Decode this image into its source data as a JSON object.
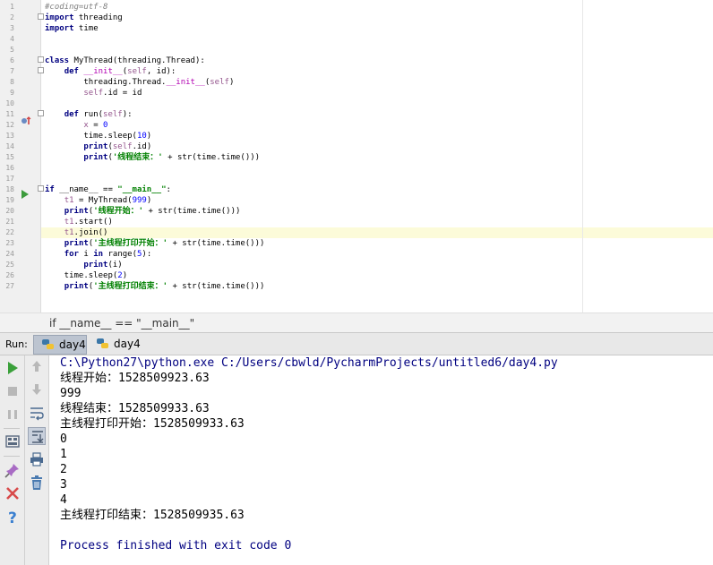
{
  "editor": {
    "current_line": 22,
    "lines": [
      {
        "n": 1,
        "parts": [
          {
            "t": "#coding=utf-8",
            "c": "cm"
          }
        ]
      },
      {
        "n": 2,
        "parts": [
          {
            "t": "import",
            "c": "kw"
          },
          {
            "t": " threading",
            "c": "plain"
          }
        ]
      },
      {
        "n": 3,
        "parts": [
          {
            "t": "import",
            "c": "kw"
          },
          {
            "t": " time",
            "c": "plain"
          }
        ]
      },
      {
        "n": 4,
        "parts": []
      },
      {
        "n": 5,
        "parts": []
      },
      {
        "n": 6,
        "parts": [
          {
            "t": "class",
            "c": "kw"
          },
          {
            "t": " MyThread(threading.Thread):",
            "c": "plain"
          }
        ]
      },
      {
        "n": 7,
        "parts": [
          {
            "t": "    ",
            "c": "plain"
          },
          {
            "t": "def",
            "c": "kw"
          },
          {
            "t": " ",
            "c": "plain"
          },
          {
            "t": "__init__",
            "c": "mag"
          },
          {
            "t": "(",
            "c": "plain"
          },
          {
            "t": "self",
            "c": "self"
          },
          {
            "t": ", id):",
            "c": "plain"
          }
        ]
      },
      {
        "n": 8,
        "parts": [
          {
            "t": "        threading.Thread.",
            "c": "plain"
          },
          {
            "t": "__init__",
            "c": "mag"
          },
          {
            "t": "(",
            "c": "plain"
          },
          {
            "t": "self",
            "c": "self"
          },
          {
            "t": ")",
            "c": "plain"
          }
        ]
      },
      {
        "n": 9,
        "parts": [
          {
            "t": "        ",
            "c": "plain"
          },
          {
            "t": "self",
            "c": "self"
          },
          {
            "t": ".id = id",
            "c": "plain"
          }
        ]
      },
      {
        "n": 10,
        "parts": []
      },
      {
        "n": 11,
        "parts": [
          {
            "t": "    ",
            "c": "plain"
          },
          {
            "t": "def",
            "c": "kw"
          },
          {
            "t": " run(",
            "c": "plain"
          },
          {
            "t": "self",
            "c": "self"
          },
          {
            "t": "):",
            "c": "plain"
          }
        ]
      },
      {
        "n": 12,
        "parts": [
          {
            "t": "        ",
            "c": "plain"
          },
          {
            "t": "x",
            "c": "self"
          },
          {
            "t": " = ",
            "c": "plain"
          },
          {
            "t": "0",
            "c": "num"
          }
        ]
      },
      {
        "n": 13,
        "parts": [
          {
            "t": "        time.sleep(",
            "c": "plain"
          },
          {
            "t": "10",
            "c": "num"
          },
          {
            "t": ")",
            "c": "plain"
          }
        ]
      },
      {
        "n": 14,
        "parts": [
          {
            "t": "        ",
            "c": "plain"
          },
          {
            "t": "print",
            "c": "kw"
          },
          {
            "t": "(",
            "c": "plain"
          },
          {
            "t": "self",
            "c": "self"
          },
          {
            "t": ".id)",
            "c": "plain"
          }
        ]
      },
      {
        "n": 15,
        "parts": [
          {
            "t": "        ",
            "c": "plain"
          },
          {
            "t": "print",
            "c": "kw"
          },
          {
            "t": "(",
            "c": "plain"
          },
          {
            "t": "'线程结束：'",
            "c": "str"
          },
          {
            "t": " + str(time.time()))",
            "c": "plain"
          }
        ]
      },
      {
        "n": 16,
        "parts": []
      },
      {
        "n": 17,
        "parts": []
      },
      {
        "n": 18,
        "parts": [
          {
            "t": "if",
            "c": "kw"
          },
          {
            "t": " __name__ == ",
            "c": "plain"
          },
          {
            "t": "\"__main__\"",
            "c": "str"
          },
          {
            "t": ":",
            "c": "plain"
          }
        ]
      },
      {
        "n": 19,
        "parts": [
          {
            "t": "    ",
            "c": "plain"
          },
          {
            "t": "t1",
            "c": "self"
          },
          {
            "t": " = MyThread(",
            "c": "plain"
          },
          {
            "t": "999",
            "c": "num"
          },
          {
            "t": ")",
            "c": "plain"
          }
        ]
      },
      {
        "n": 20,
        "parts": [
          {
            "t": "    ",
            "c": "plain"
          },
          {
            "t": "print",
            "c": "kw"
          },
          {
            "t": "(",
            "c": "plain"
          },
          {
            "t": "'线程开始：'",
            "c": "str"
          },
          {
            "t": " + str(time.time()))",
            "c": "plain"
          }
        ]
      },
      {
        "n": 21,
        "parts": [
          {
            "t": "    ",
            "c": "plain"
          },
          {
            "t": "t1",
            "c": "self"
          },
          {
            "t": ".start()",
            "c": "plain"
          }
        ]
      },
      {
        "n": 22,
        "parts": [
          {
            "t": "    ",
            "c": "plain"
          },
          {
            "t": "t1",
            "c": "self"
          },
          {
            "t": ".join()",
            "c": "plain"
          }
        ]
      },
      {
        "n": 23,
        "parts": [
          {
            "t": "    ",
            "c": "plain"
          },
          {
            "t": "print",
            "c": "kw"
          },
          {
            "t": "(",
            "c": "plain"
          },
          {
            "t": "'主线程打印开始：'",
            "c": "str"
          },
          {
            "t": " + str(time.time()))",
            "c": "plain"
          }
        ]
      },
      {
        "n": 24,
        "parts": [
          {
            "t": "    ",
            "c": "plain"
          },
          {
            "t": "for",
            "c": "kw"
          },
          {
            "t": " i ",
            "c": "plain"
          },
          {
            "t": "in",
            "c": "kw"
          },
          {
            "t": " range(",
            "c": "plain"
          },
          {
            "t": "5",
            "c": "num"
          },
          {
            "t": "):",
            "c": "plain"
          }
        ]
      },
      {
        "n": 25,
        "parts": [
          {
            "t": "        ",
            "c": "plain"
          },
          {
            "t": "print",
            "c": "kw"
          },
          {
            "t": "(i)",
            "c": "plain"
          }
        ]
      },
      {
        "n": 26,
        "parts": [
          {
            "t": "    time.sleep(",
            "c": "plain"
          },
          {
            "t": "2",
            "c": "num"
          },
          {
            "t": ")",
            "c": "plain"
          }
        ]
      },
      {
        "n": 27,
        "parts": [
          {
            "t": "    ",
            "c": "plain"
          },
          {
            "t": "print",
            "c": "kw"
          },
          {
            "t": "(",
            "c": "plain"
          },
          {
            "t": "'主线程打印结束：'",
            "c": "str"
          },
          {
            "t": " + str(time.time()))",
            "c": "plain"
          }
        ]
      }
    ]
  },
  "breadcrumb": {
    "text": "if __name__ == \"__main__\""
  },
  "run": {
    "label": "Run:",
    "tabs": [
      {
        "label": "day4",
        "active": true
      },
      {
        "label": "day4",
        "active": false
      }
    ]
  },
  "console": {
    "lines": [
      {
        "text": "C:\\Python27\\python.exe C:/Users/cbwld/PycharmProjects/untitled6/day4.py",
        "kind": "cmd"
      },
      {
        "text": "线程开始：1528509923.63",
        "kind": "out"
      },
      {
        "text": "999",
        "kind": "out"
      },
      {
        "text": "线程结束：1528509933.63",
        "kind": "out"
      },
      {
        "text": "主线程打印开始：1528509933.63",
        "kind": "out"
      },
      {
        "text": "0",
        "kind": "out"
      },
      {
        "text": "1",
        "kind": "out"
      },
      {
        "text": "2",
        "kind": "out"
      },
      {
        "text": "3",
        "kind": "out"
      },
      {
        "text": "4",
        "kind": "out"
      },
      {
        "text": "主线程打印结束：1528509935.63",
        "kind": "out"
      },
      {
        "text": "",
        "kind": "blank"
      },
      {
        "text": "Process finished with exit code 0",
        "kind": "exit"
      }
    ]
  },
  "colors": {
    "keyword": "#000080",
    "string": "#008000",
    "number": "#0000ff",
    "self": "#94558d",
    "comment": "#808080",
    "current_line": "#fcfbd9"
  }
}
